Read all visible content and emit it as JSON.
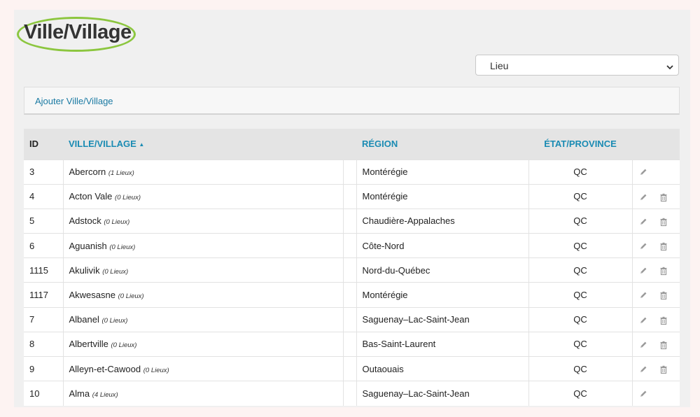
{
  "header": {
    "title": "Ville/Village"
  },
  "filter": {
    "selected": "Lieu"
  },
  "actions": {
    "add_label": "Ajouter Ville/Village"
  },
  "table": {
    "columns": {
      "id": "ID",
      "ville": "VILLE/VILLAGE",
      "region": "RÉGION",
      "etat": "ÉTAT/PROVINCE"
    },
    "rows": [
      {
        "id": "3",
        "ville": "Abercorn",
        "count": "(1 Lieux)",
        "region": "Montérégie",
        "etat": "QC",
        "deletable": false
      },
      {
        "id": "4",
        "ville": "Acton Vale",
        "count": "(0 Lieux)",
        "region": "Montérégie",
        "etat": "QC",
        "deletable": true
      },
      {
        "id": "5",
        "ville": "Adstock",
        "count": "(0 Lieux)",
        "region": "Chaudière-Appalaches",
        "etat": "QC",
        "deletable": true
      },
      {
        "id": "6",
        "ville": "Aguanish",
        "count": "(0 Lieux)",
        "region": "Côte-Nord",
        "etat": "QC",
        "deletable": true
      },
      {
        "id": "1115",
        "ville": "Akulivik",
        "count": "(0 Lieux)",
        "region": "Nord-du-Québec",
        "etat": "QC",
        "deletable": true
      },
      {
        "id": "1117",
        "ville": "Akwesasne",
        "count": "(0 Lieux)",
        "region": "Montérégie",
        "etat": "QC",
        "deletable": true
      },
      {
        "id": "7",
        "ville": "Albanel",
        "count": "(0 Lieux)",
        "region": "Saguenay–Lac-Saint-Jean",
        "etat": "QC",
        "deletable": true
      },
      {
        "id": "8",
        "ville": "Albertville",
        "count": "(0 Lieux)",
        "region": "Bas-Saint-Laurent",
        "etat": "QC",
        "deletable": true
      },
      {
        "id": "9",
        "ville": "Alleyn-et-Cawood",
        "count": "(0 Lieux)",
        "region": "Outaouais",
        "etat": "QC",
        "deletable": true
      },
      {
        "id": "10",
        "ville": "Alma",
        "count": "(4 Lieux)",
        "region": "Saguenay–Lac-Saint-Jean",
        "etat": "QC",
        "deletable": false
      }
    ]
  },
  "icons": {
    "edit": "pencil-icon",
    "delete": "trash-icon",
    "sort": "sort-ascending-icon",
    "select": "chevron-down-icon"
  },
  "colors": {
    "link": "#1a8bb3",
    "highlight": "#8cc63f",
    "header_bg": "#e4e4e4",
    "panel_bg": "#f0f0f0",
    "page_bg": "#fdf3f2"
  }
}
